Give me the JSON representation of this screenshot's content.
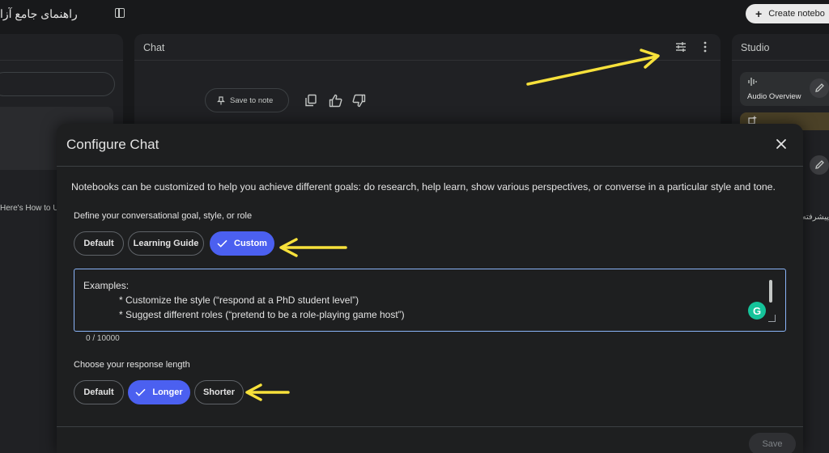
{
  "app": {
    "notebook_title": "راهنمای جامع آزا",
    "create_button_label": "Create notebo"
  },
  "panels": {
    "chat_title": "Chat",
    "studio_title": "Studio",
    "left_snippet": "Here's How to U",
    "right_snippet": "پیشرفته و",
    "save_to_note_label": "Save to note",
    "studio_audio_label": "Audio Overview"
  },
  "dialog": {
    "title": "Configure Chat",
    "description": "Notebooks can be customized to help you achieve different goals: do research, help learn, show various perspectives, or converse in a particular style and tone.",
    "goal_label": "Define your conversational goal, style, or role",
    "goal_options": [
      {
        "label": "Default",
        "selected": false
      },
      {
        "label": "Learning Guide",
        "selected": false
      },
      {
        "label": "Custom",
        "selected": true
      }
    ],
    "textarea": {
      "line0": "Examples:",
      "line1": "* Customize the style (“respond at a PhD student level”)",
      "line2": "* Suggest different roles (“pretend to be a role-playing game host”)"
    },
    "char_count": "0 / 10000",
    "length_label": "Choose your response length",
    "length_options": [
      {
        "label": "Default",
        "selected": false
      },
      {
        "label": "Longer",
        "selected": true
      },
      {
        "label": "Shorter",
        "selected": false
      }
    ],
    "save_label": "Save"
  },
  "icons": {
    "top_plus": "plus-icon",
    "chat_tune": "tune-icon",
    "chat_more": "more-vert-icon",
    "close": "close-icon",
    "check": "check-icon",
    "grammarly": "G"
  },
  "colors": {
    "accent": "#4b60f0",
    "annotation_arrow": "#f7e13b",
    "background": "#18191b",
    "dialog": "#1e1f20"
  }
}
